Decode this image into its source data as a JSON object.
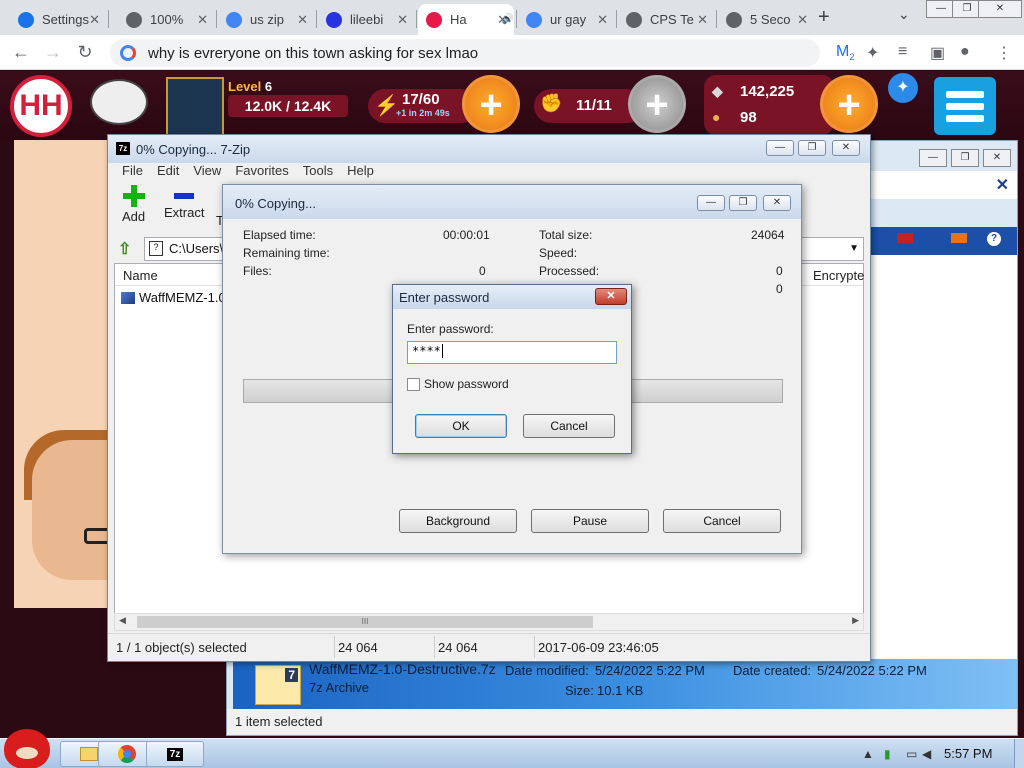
{
  "browser": {
    "tabs": [
      {
        "label": "Settings",
        "icon": "settings-gear-icon",
        "color": "#1a73e8",
        "active": false
      },
      {
        "label": "100%",
        "icon": "globe-icon",
        "color": "#5f6368",
        "active": false
      },
      {
        "label": "us zip",
        "icon": "google-icon",
        "color": "#4285f4",
        "active": false
      },
      {
        "label": "lileebi",
        "icon": "paw-icon",
        "color": "#2932e1",
        "active": false
      },
      {
        "label": "Ha",
        "icon": "nutaku-icon",
        "color": "#e6194b",
        "active": true
      },
      {
        "label": "ur gay",
        "icon": "google-icon",
        "color": "#4285f4",
        "active": false
      },
      {
        "label": "CPS Te",
        "icon": "globe-icon",
        "color": "#5f6368",
        "active": false
      },
      {
        "label": "5 Seco",
        "icon": "globe-icon",
        "color": "#5f6368",
        "active": false
      }
    ],
    "new_tab": "+",
    "omnibox_text": "why is evreryone on this town asking for sex lmao",
    "profile_badge": "2"
  },
  "game": {
    "level_label": "Level",
    "level": "6",
    "xp": "12.0K / 12.4K",
    "energy": "17/60",
    "energy_timer": "+1 in 2m 49s",
    "fights": "11/11",
    "money": "142,225",
    "kobans": "98",
    "logo_text": "HH"
  },
  "explorer": {
    "status": "1 item selected",
    "file_name": "WaffMEMZ-1.0-Destructive.7z",
    "file_type": "7z Archive",
    "date_modified_label": "Date modified:",
    "date_modified": "5/24/2022 5:22 PM",
    "date_created_label": "Date created:",
    "date_created": "5/24/2022 5:22 PM",
    "size_label": "Size:",
    "size": "10.1 KB",
    "file_badge": "7"
  },
  "zip": {
    "title": "0% Copying... 7-Zip",
    "icon_text": "7z",
    "menus": [
      "File",
      "Edit",
      "View",
      "Favorites",
      "Tools",
      "Help"
    ],
    "tools": [
      {
        "label": "Add"
      },
      {
        "label": "Extract"
      },
      {
        "label": "T"
      }
    ],
    "address": "C:\\Users\\",
    "columns": {
      "name": "Name",
      "encrypted": "Encrypte"
    },
    "row_name": "WaffMEMZ-1.0",
    "status": [
      "1 / 1 object(s) selected",
      "24 064",
      "24 064",
      "2017-06-09 23:46:05"
    ],
    "scroll_grip": "III"
  },
  "progress": {
    "title": "0% Copying...",
    "elapsed_label": "Elapsed time:",
    "elapsed": "00:00:01",
    "remaining_label": "Remaining time:",
    "files_label": "Files:",
    "files": "0",
    "total_label": "Total size:",
    "total": "24064",
    "speed_label": "Speed:",
    "processed_label": "Processed:",
    "processed": "0",
    "extra_value": "0",
    "buttons": {
      "background": "Background",
      "pause": "Pause",
      "cancel": "Cancel"
    }
  },
  "password": {
    "title": "Enter password",
    "label": "Enter password:",
    "value": "****",
    "show_label": "Show password",
    "ok": "OK",
    "cancel": "Cancel"
  },
  "taskbar": {
    "clock": "5:57 PM",
    "icon_7z": "7z"
  }
}
